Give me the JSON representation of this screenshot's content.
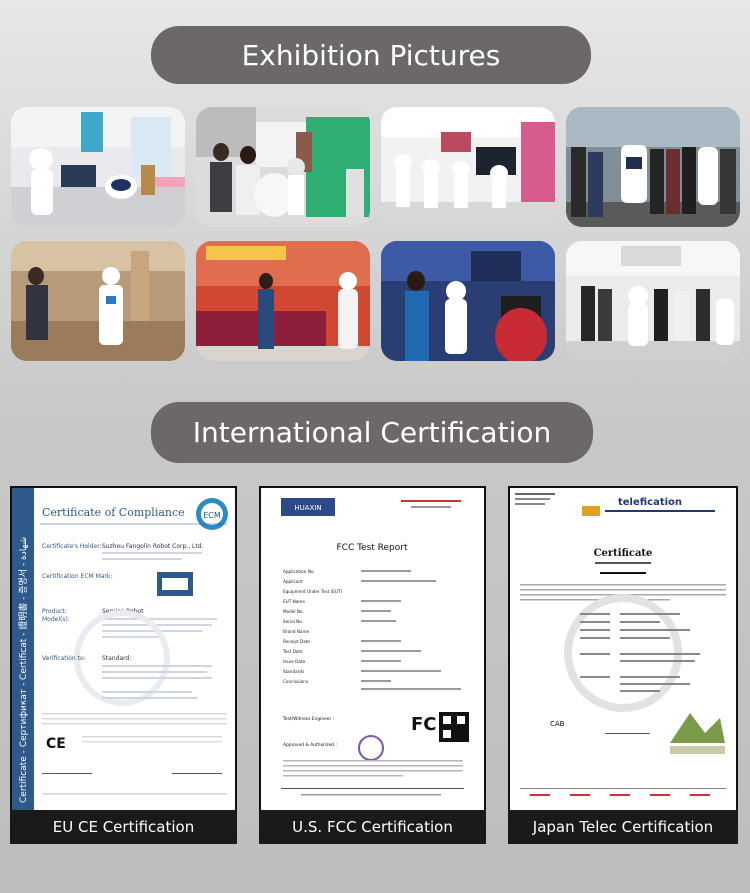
{
  "sections": {
    "exhibition_title": "Exhibition Pictures",
    "certification_title": "International Certification"
  },
  "photos": [
    {
      "scene": "booth-robots"
    },
    {
      "scene": "visitors-robot"
    },
    {
      "scene": "showroom-robots"
    },
    {
      "scene": "group-outdoor"
    },
    {
      "scene": "lobby-robot"
    },
    {
      "scene": "red-stage"
    },
    {
      "scene": "interview"
    },
    {
      "scene": "team-booth"
    }
  ],
  "certificates": {
    "eu": {
      "caption": "EU CE Certification",
      "title": "Certificate of Compliance",
      "side_text": "Certificate - Сертификат - Certificat - 證明書 - 증명서 - شهادة",
      "holder_label": "Certificate's Holder:",
      "holder_value": "Suzhou Fangolin Robot Corp., Ltd.",
      "mark_label": "Certification ECM Mark:",
      "product_label": "Product:",
      "model_label": "Model(s):",
      "product_value": "Service Robot",
      "verification_label": "Verification to:",
      "standard_label": "Standard:",
      "ce_mark": "CE",
      "badge_text": "ECM"
    },
    "us": {
      "caption": "U.S. FCC Certification",
      "title": "FCC Test Report",
      "logo_text": "HUAXIN",
      "rows": [
        "Application No.",
        "Applicant",
        "Equipment Under Test (EUT)",
        "EUT Name",
        "Model No.",
        "Serial No.",
        "Brand Name",
        "Receipt Date",
        "Test Date",
        "Issue Date",
        "Standards",
        "Conclusions"
      ],
      "fcc_mark": "FC",
      "engineer_label": "Test/Witness Engineer :",
      "approved_label": "Approved & Authorized :"
    },
    "jp": {
      "caption": "Japan Telec Certification",
      "brand": "telefication",
      "title": "Certificate",
      "cab_label": "CAB"
    }
  }
}
